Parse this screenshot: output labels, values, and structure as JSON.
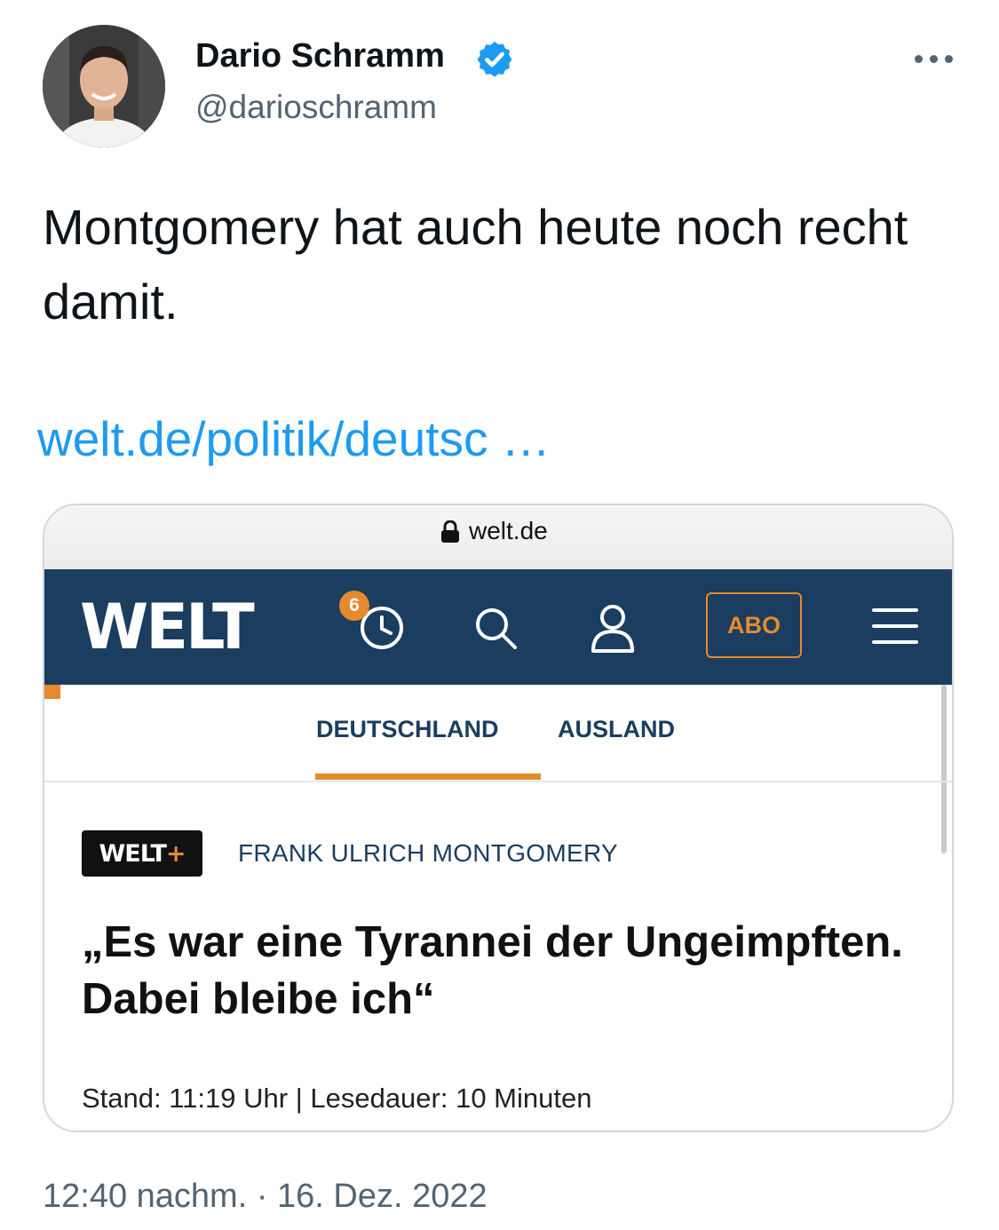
{
  "tweet": {
    "author_name": "Dario Schramm",
    "handle": "@darioschramm",
    "text": "Montgomery hat auch heute noch recht damit.",
    "link_text": "welt.de/politik/deutsc …",
    "timestamp": "12:40 nachm. · 16. Dez. 2022",
    "verified": true
  },
  "card": {
    "url": "welt.de",
    "logo": "WELT",
    "history_count": "6",
    "abo_label": "ABO",
    "tabs": [
      {
        "label": "DEUTSCHLAND",
        "active": true
      },
      {
        "label": "AUSLAND",
        "active": false
      }
    ],
    "badge": {
      "text": "WELT",
      "plus": "+"
    },
    "kicker": "FRANK ULRICH MONTGOMERY",
    "headline": "„Es war eine Tyrannei der Ungeimpften. Dabei bleibe ich“",
    "meta": "Stand: 11:19 Uhr | Lesedauer: 10 Minuten"
  },
  "colors": {
    "link": "#1d9bf0",
    "welt_navy": "#1b3d5f",
    "welt_orange": "#e58a2f",
    "secondary_text": "#536471"
  },
  "icons": [
    "verified-badge-icon",
    "more-options-icon",
    "lock-icon",
    "history-clock-icon",
    "search-icon",
    "user-icon",
    "menu-icon"
  ]
}
